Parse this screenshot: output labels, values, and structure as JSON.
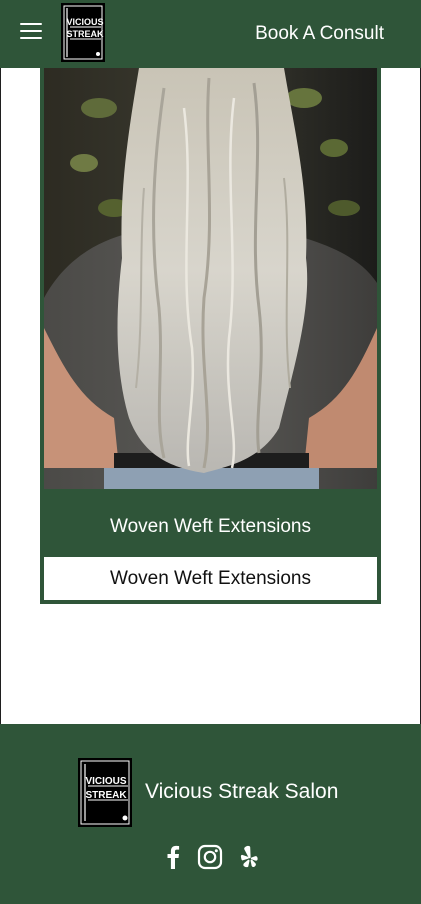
{
  "header": {
    "logo_text_top": "VICIOUS",
    "logo_text_bottom": "STREAK",
    "cta_label": "Book A Consult"
  },
  "card": {
    "title": "Woven Weft Extensions",
    "button_label": "Woven Weft Extensions",
    "image_alt": "Long wavy platinum blonde hair with extensions, viewed from behind"
  },
  "footer": {
    "logo_text_top": "VICIOUS",
    "logo_text_bottom": "STREAK",
    "salon_name": "Vicious Streak Salon",
    "social": [
      "facebook-icon",
      "instagram-icon",
      "yelp-icon"
    ]
  },
  "colors": {
    "brand_green": "#2f5539",
    "white": "#ffffff"
  }
}
